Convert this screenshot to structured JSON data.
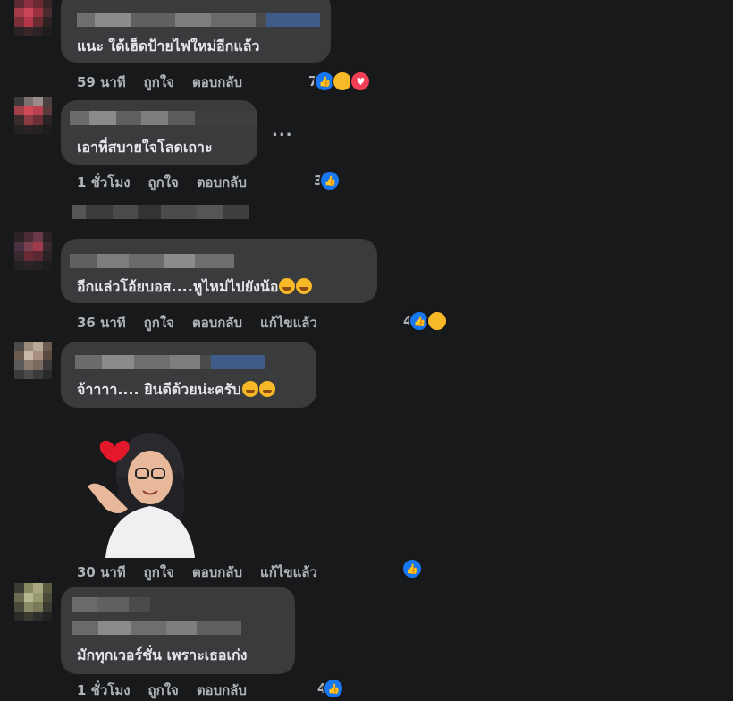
{
  "comments": [
    {
      "text": "แนะ ใด้เฮ็ดป้ายไฟใหม่อีกแล้ว",
      "time": "59 นาที",
      "like": "ถูกใจ",
      "reply": "ตอบกลับ",
      "reaction_count": "7",
      "reactions": [
        "like-icon",
        "haha-icon",
        "love-icon"
      ]
    },
    {
      "text": "เอาที่สบายใจโลดเถาะ",
      "time": "1 ชั่วโมง",
      "like": "ถูกใจ",
      "reply": "ตอบกลับ",
      "reaction_count": "3",
      "reactions": [
        "like-icon"
      ],
      "more": "..."
    },
    {
      "text": "อีกแล่วโอ้ยบอส....หูไหม่ไปยังน้อ",
      "time": "36 นาที",
      "like": "ถูกใจ",
      "reply": "ตอบกลับ",
      "edited": "แก้ไขแล้ว",
      "reaction_count": "4",
      "reactions": [
        "like-icon",
        "haha-icon"
      ]
    },
    {
      "text": "จ้าาาา.... ยินดีด้วยน่ะครับ",
      "time": "30 นาที",
      "like": "ถูกใจ",
      "reply": "ตอบกลับ",
      "edited": "แก้ไขแล้ว",
      "reactions": [
        "like-icon"
      ]
    },
    {
      "text": "มักทุกเวอร์ชั่น เพราะเธอเก่ง",
      "time": "1 ชั่วโมง",
      "like": "ถูกใจ",
      "reply": "ตอบกลับ",
      "reaction_count": "4"
    }
  ],
  "colors": {
    "background": "#18191a",
    "bubble": "#3a3b3c",
    "text": "#e4e6eb",
    "secondary": "#b0b3b8",
    "like_blue": "#1877f2"
  }
}
